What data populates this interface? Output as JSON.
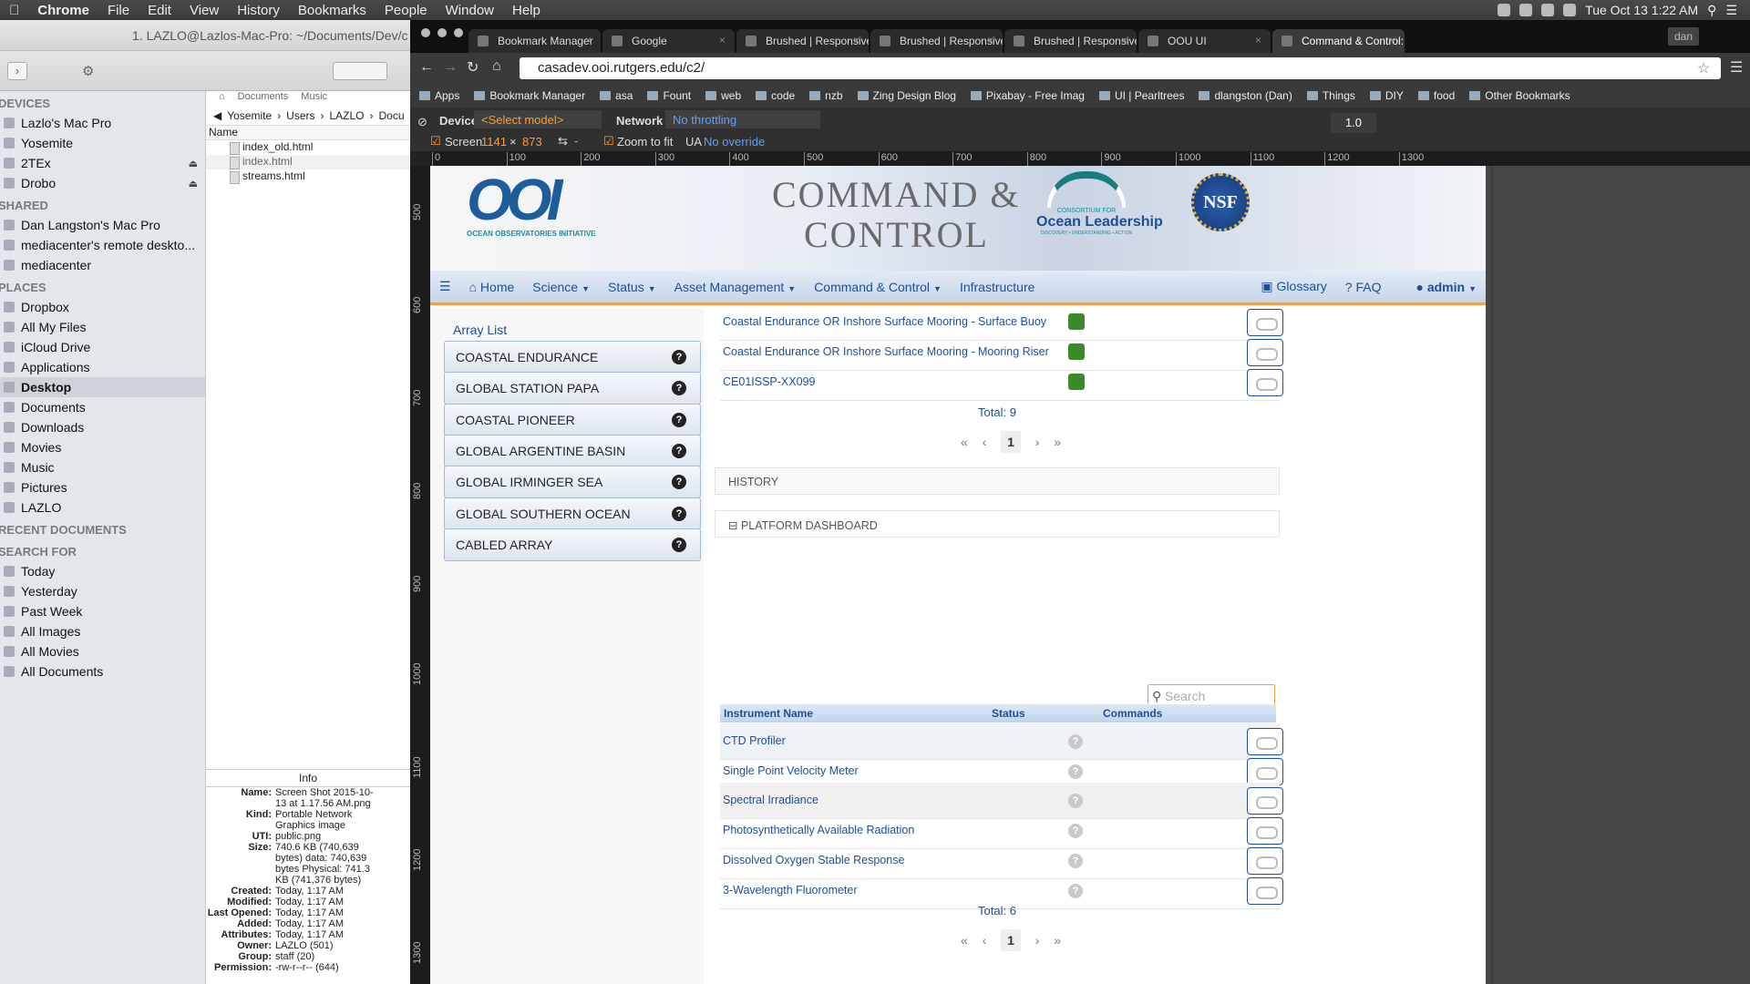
{
  "menubar": {
    "app": "Chrome",
    "items": [
      "File",
      "Edit",
      "View",
      "History",
      "Bookmarks",
      "People",
      "Window",
      "Help"
    ],
    "clock": "Tue Oct 13 1:22 AM"
  },
  "finder": {
    "title": "1. LAZLO@Lazlos-Mac-Pro: ~/Documents/Dev/c",
    "toolbar_labels": [
      "Documents",
      "Music"
    ],
    "path": [
      "Yosemite",
      "Users",
      "LAZLO",
      "Docu"
    ],
    "column_name": "Name",
    "files": [
      "index_old.html",
      "index.html",
      "streams.html"
    ],
    "sections": [
      {
        "title": "DEVICES",
        "items": [
          "Lazlo's Mac Pro",
          "Yosemite",
          "2TEx",
          "Drobo"
        ]
      },
      {
        "title": "SHARED",
        "items": [
          "Dan Langston's Mac Pro",
          "mediacenter's remote deskto...",
          "mediacenter"
        ]
      },
      {
        "title": "PLACES",
        "items": [
          "Dropbox",
          "All My Files",
          "iCloud Drive",
          "Applications",
          "Desktop",
          "Documents",
          "Downloads",
          "Movies",
          "Music",
          "Pictures",
          "LAZLO"
        ]
      },
      {
        "title": "RECENT DOCUMENTS",
        "items": []
      },
      {
        "title": "SEARCH FOR",
        "items": [
          "Today",
          "Yesterday",
          "Past Week",
          "All Images",
          "All Movies",
          "All Documents"
        ]
      }
    ],
    "selected_place": "Desktop",
    "info": {
      "header": "Info",
      "rows": [
        [
          "Name:",
          "Screen Shot 2015-10-13 at 1.17.56 AM.png"
        ],
        [
          "Kind:",
          "Portable Network Graphics image"
        ],
        [
          "UTI:",
          "public.png"
        ],
        [
          "Size:",
          "740.6 KB (740,639 bytes) data: 740,639 bytes Physical: 741.3 KB (741,376 bytes)"
        ],
        [
          "Created:",
          "Today, 1:17 AM"
        ],
        [
          "Modified:",
          "Today, 1:17 AM"
        ],
        [
          "Last Opened:",
          "Today, 1:17 AM"
        ],
        [
          "Added:",
          "Today, 1:17 AM"
        ],
        [
          "Attributes:",
          "Today, 1:17 AM"
        ],
        [
          "Owner:",
          "LAZLO (501)"
        ],
        [
          "Group:",
          "staff (20)"
        ],
        [
          "Permission:",
          "-rw-r--r-- (644)"
        ]
      ]
    }
  },
  "chrome": {
    "tabs": [
      "Bookmark Manager",
      "Google",
      "Brushed | Responsive C",
      "Brushed | Responsive C",
      "Brushed | Responsive C",
      "OOU UI",
      "Command & Control: La"
    ],
    "profile": "dan",
    "url": "casadev.ooi.rutgers.edu/c2/",
    "bookmarks": [
      "Apps",
      "Bookmark Manager",
      "asa",
      "Fount",
      "web",
      "code",
      "nzb",
      "Zing Design Blog",
      "Pixabay - Free Imag",
      "UI | Pearltrees",
      "dlangston (Dan)",
      "Things",
      "DIY",
      "food",
      "Other Bookmarks"
    ],
    "devtools": {
      "device_label": "Device",
      "model": "<Select model>",
      "network_label": "Network",
      "throttle": "No throttling",
      "screen_label": "Screen",
      "width": "1141",
      "height": "873",
      "zoom_to_fit": "Zoom to fit",
      "ua_label": "UA",
      "ua_value": "No override",
      "zoom": "1.0"
    },
    "ruler_h": [
      "0",
      "100",
      "200",
      "300",
      "400",
      "500",
      "600",
      "700",
      "800",
      "900",
      "1000",
      "1100",
      "1200",
      "1300"
    ],
    "ruler_v": [
      "500",
      "600",
      "700",
      "800",
      "900",
      "1000",
      "1100",
      "1200",
      "1300"
    ]
  },
  "site": {
    "ooi_logo": "OOI",
    "ooi_sub": "OCEAN OBSERVATORIES INITIATIVE",
    "title_line1": "COMMAND &",
    "title_line2": "CONTROL",
    "col_logo_small": "CONSORTIUM FOR",
    "col_logo_big": "Ocean Leadership",
    "col_logo_tag": "DISCOVERY • UNDERSTANDING • ACTION",
    "nsf": "NSF",
    "nav": {
      "home": "Home",
      "science": "Science",
      "status": "Status",
      "asset": "Asset Management",
      "command": "Command & Control",
      "infra": "Infrastructure",
      "glossary": "Glossary",
      "faq": "FAQ",
      "user": "admin"
    },
    "array_list_title": "Array List",
    "arrays": [
      "COASTAL ENDURANCE",
      "GLOBAL STATION PAPA",
      "COASTAL PIONEER",
      "GLOBAL ARGENTINE BASIN",
      "GLOBAL IRMINGER SEA",
      "GLOBAL SOUTHERN OCEAN",
      "CABLED ARRAY"
    ],
    "platforms": [
      "Coastal Endurance OR Inshore Surface Mooring - Surface Buoy",
      "Coastal Endurance OR Inshore Surface Mooring - Mooring Riser",
      "CE01ISSP-XX099"
    ],
    "platforms_total": "Total: 9",
    "page": "1",
    "history_label": "HISTORY",
    "dashboard_label": "PLATFORM DASHBOARD",
    "search_placeholder": "Search",
    "table_headers": {
      "name": "Instrument Name",
      "status": "Status",
      "commands": "Commands"
    },
    "instruments": [
      "CTD Profiler",
      "Single Point Velocity Meter",
      "Spectral Irradiance",
      "Photosynthetically Available Radiation",
      "Dissolved Oxygen Stable Response",
      "3-Wavelength Fluorometer"
    ],
    "instruments_total": "Total: 6"
  },
  "colors": {
    "brand_blue": "#1d4e9a",
    "accent_orange": "#f0a050",
    "thumb_green": "#3a8a2a"
  }
}
